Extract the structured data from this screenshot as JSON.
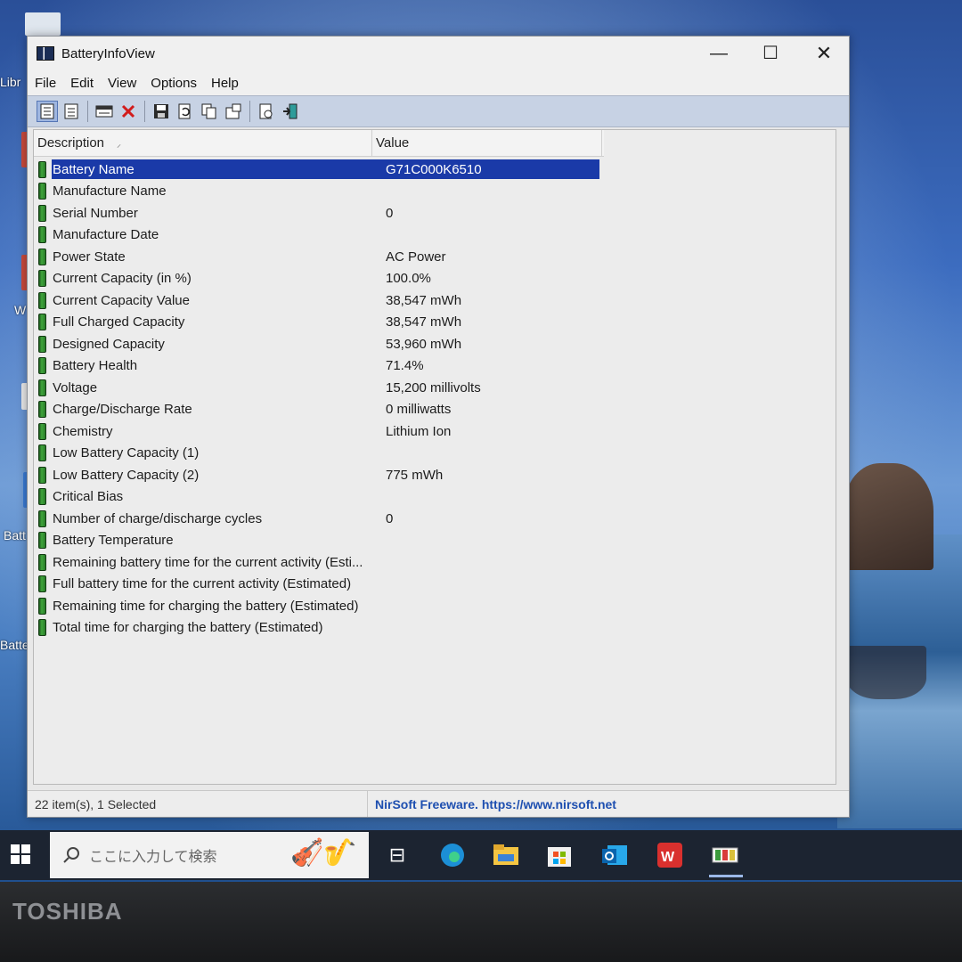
{
  "window": {
    "title": "BatteryInfoView",
    "minimize_glyph": "—",
    "maximize_glyph": "☐",
    "close_glyph": "✕"
  },
  "menu": [
    "File",
    "Edit",
    "View",
    "Options",
    "Help"
  ],
  "toolbar_icons": [
    "html-report-icon",
    "properties-icon",
    "battery-log-icon",
    "delete-icon",
    "save-icon",
    "refresh-icon",
    "copy-icon",
    "options-icon",
    "about-icon",
    "exit-icon"
  ],
  "columns": {
    "description": "Description",
    "sort_indicator": "⸝",
    "value": "Value"
  },
  "rows": [
    {
      "desc": "Battery Name",
      "val": "G71C000K6510",
      "selected": true
    },
    {
      "desc": "Manufacture Name",
      "val": ""
    },
    {
      "desc": "Serial Number",
      "val": "0"
    },
    {
      "desc": "Manufacture Date",
      "val": ""
    },
    {
      "desc": "Power State",
      "val": "AC Power"
    },
    {
      "desc": "Current Capacity (in %)",
      "val": "100.0%"
    },
    {
      "desc": "Current Capacity Value",
      "val": "38,547 mWh"
    },
    {
      "desc": "Full Charged Capacity",
      "val": "38,547 mWh"
    },
    {
      "desc": "Designed Capacity",
      "val": "53,960 mWh"
    },
    {
      "desc": "Battery Health",
      "val": "71.4%"
    },
    {
      "desc": "Voltage",
      "val": "15,200 millivolts"
    },
    {
      "desc": "Charge/Discharge Rate",
      "val": "0 milliwatts"
    },
    {
      "desc": "Chemistry",
      "val": "Lithium Ion"
    },
    {
      "desc": "Low Battery Capacity (1)",
      "val": ""
    },
    {
      "desc": "Low Battery Capacity (2)",
      "val": "775 mWh"
    },
    {
      "desc": "Critical Bias",
      "val": ""
    },
    {
      "desc": "Number of charge/discharge cycles",
      "val": "0"
    },
    {
      "desc": "Battery Temperature",
      "val": ""
    },
    {
      "desc": "Remaining battery time for the current activity (Esti...",
      "val": ""
    },
    {
      "desc": "Full battery time for the current activity (Estimated)",
      "val": ""
    },
    {
      "desc": "Remaining time for charging the battery (Estimated)",
      "val": ""
    },
    {
      "desc": "Total  time for charging the battery (Estimated)",
      "val": ""
    }
  ],
  "status": {
    "count": "22 item(s), 1 Selected",
    "link": "NirSoft Freeware. https://www.nirsoft.net"
  },
  "desktop_icons": [
    "Libr",
    "W",
    "Batt",
    "Batte"
  ],
  "taskbar": {
    "search_placeholder": "ここに入力して検索",
    "apps": [
      "task-view-icon",
      "edge-icon",
      "file-explorer-icon",
      "store-icon",
      "outlook-icon",
      "wps-icon",
      "batteryinfoview-icon"
    ]
  },
  "bezel_brand": "TOSHIBA",
  "colors": {
    "selection": "#1a3aa8",
    "toolbar_bg": "#c7d2e4",
    "link": "#1e4fb0",
    "taskbar": "#1c2431"
  }
}
